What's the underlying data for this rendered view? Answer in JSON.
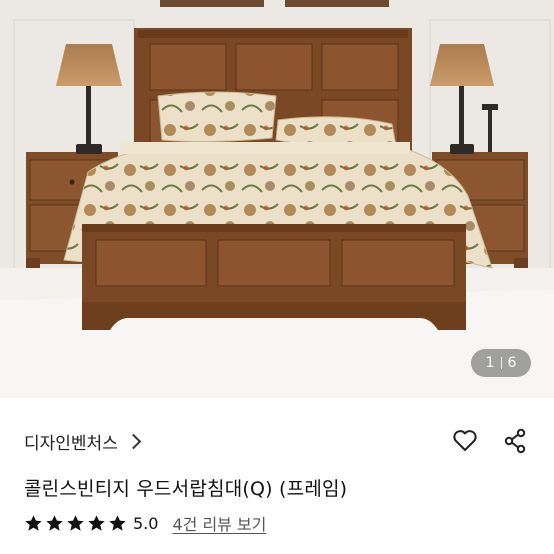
{
  "gallery": {
    "current_page": "1",
    "total_pages": "6",
    "image_alt": "wooden vintage bed with floral bedding"
  },
  "product": {
    "brand": "디자인벤처스",
    "title": "콜린스빈티지 우드서랍침대(Q) (프레임)",
    "rating": 5.0,
    "rating_label": "5.0",
    "review_link": "4건 리뷰 보기"
  },
  "icons": {
    "brand_chevron": "chevron-right-icon",
    "wishlist": "heart-icon",
    "share": "share-icon",
    "star": "star-icon"
  },
  "colors": {
    "star": "#111111",
    "wood": "#7a4a26",
    "bedding": "#e8dcc3"
  }
}
